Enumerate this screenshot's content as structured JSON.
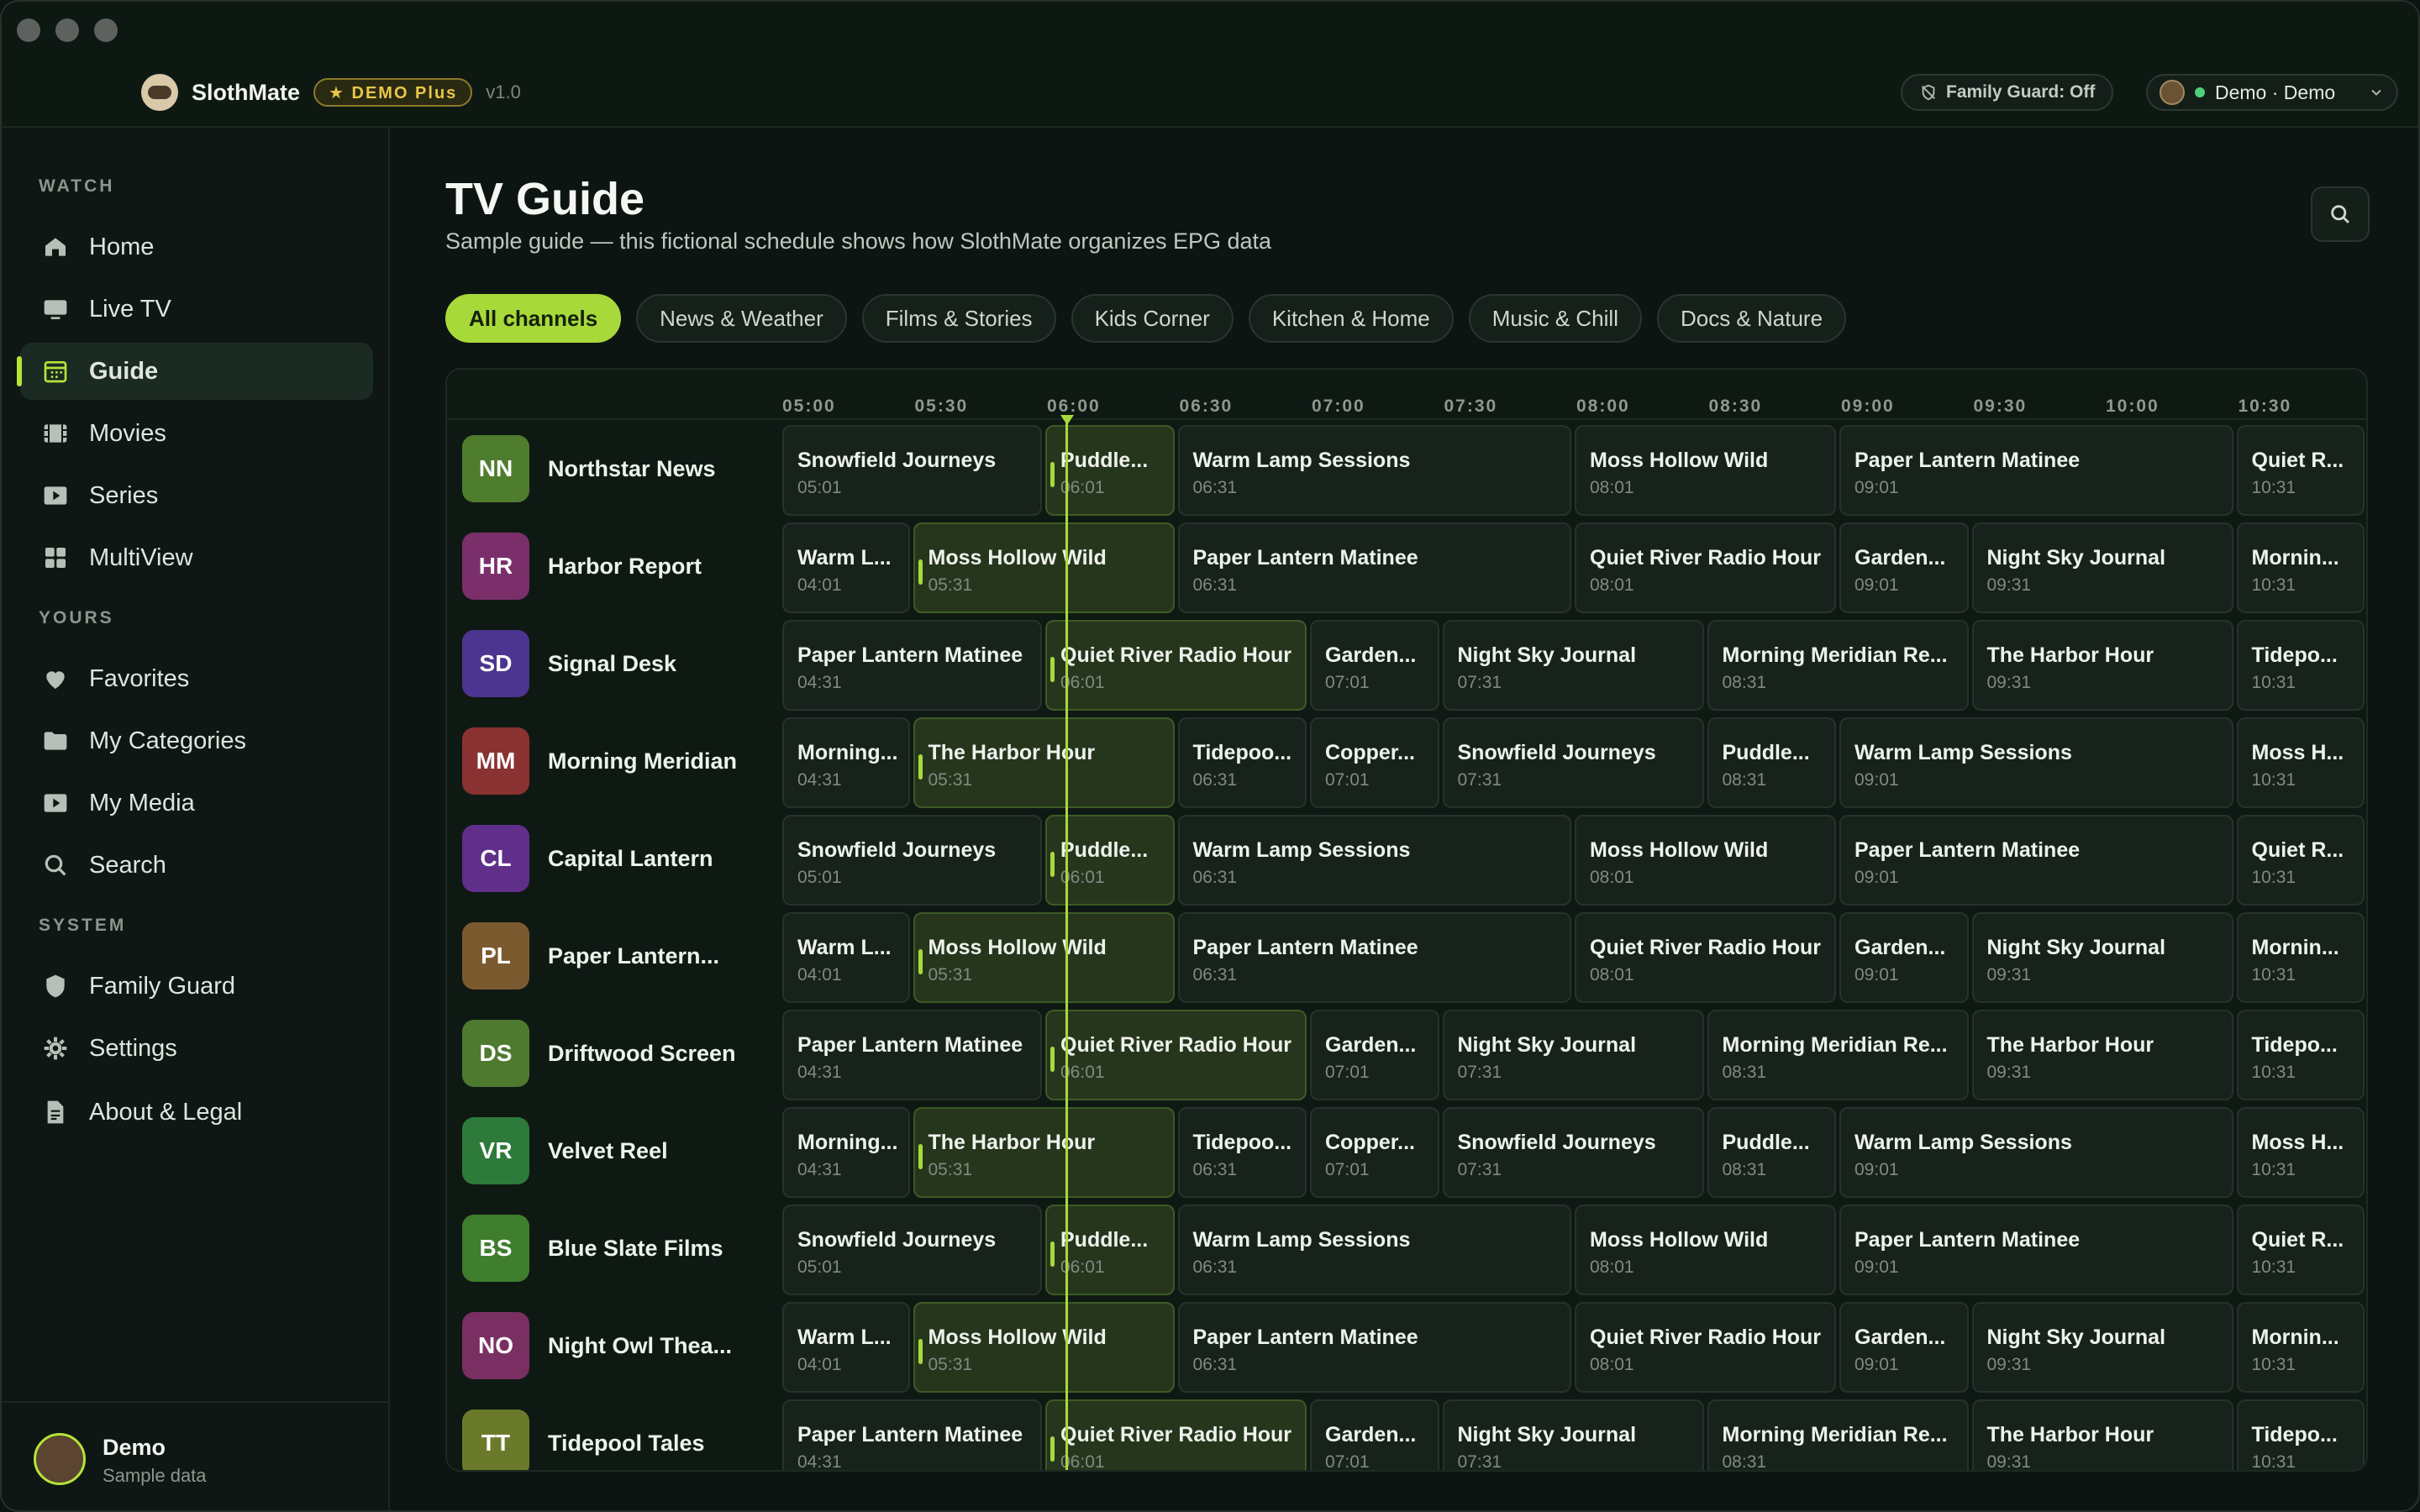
{
  "window": {
    "app_name": "SlothMate",
    "plan_badge": "★ DEMO Plus",
    "version": "v1.0"
  },
  "header": {
    "family_guard": "Family Guard: Off",
    "user_label": "Demo · Demo"
  },
  "sidebar": {
    "sections": [
      {
        "title": "WATCH",
        "items": [
          {
            "label": "Home",
            "icon": "home-icon"
          },
          {
            "label": "Live TV",
            "icon": "tv-icon"
          },
          {
            "label": "Guide",
            "icon": "grid-calendar-icon",
            "active": true
          },
          {
            "label": "Movies",
            "icon": "film-icon"
          },
          {
            "label": "Series",
            "icon": "play-square-icon"
          },
          {
            "label": "MultiView",
            "icon": "four-squares-icon"
          }
        ]
      },
      {
        "title": "YOURS",
        "items": [
          {
            "label": "Favorites",
            "icon": "heart-icon"
          },
          {
            "label": "My Categories",
            "icon": "folder-icon"
          },
          {
            "label": "My Media",
            "icon": "play-square-icon"
          },
          {
            "label": "Search",
            "icon": "search-icon"
          }
        ]
      },
      {
        "title": "SYSTEM",
        "items": [
          {
            "label": "Family Guard",
            "icon": "shield-icon"
          },
          {
            "label": "Settings",
            "icon": "gear-icon"
          },
          {
            "label": "About & Legal",
            "icon": "document-icon"
          }
        ]
      }
    ],
    "footer": {
      "name": "Demo",
      "sub": "Sample data"
    }
  },
  "main": {
    "title": "TV Guide",
    "subtitle": "Sample guide — this fictional schedule shows how SlothMate organizes EPG data",
    "chips": [
      "All channels",
      "News & Weather",
      "Films & Stories",
      "Kids Corner",
      "Kitchen & Home",
      "Music & Chill",
      "Docs & Nature"
    ],
    "active_chip": "All channels"
  },
  "guide": {
    "times": [
      "05:00",
      "05:30",
      "06:00",
      "06:30",
      "07:00",
      "07:30",
      "08:00",
      "08:30",
      "09:00",
      "09:30",
      "10:00",
      "10:30"
    ],
    "accent": "#a8d93a",
    "patterns": [
      [
        [
          "Snowfield Journeys",
          "05:01"
        ],
        [
          "Puddle...",
          "06:01"
        ],
        [
          "Warm Lamp Sessions",
          "06:31"
        ],
        [
          "Moss Hollow Wild",
          "08:01"
        ],
        [
          "Paper Lantern Matinee",
          "09:01"
        ],
        [
          "Quiet R...",
          "10:31"
        ]
      ],
      [
        [
          "Warm L...",
          "04:01"
        ],
        [
          "Moss Hollow Wild",
          "05:31"
        ],
        [
          "Paper Lantern Matinee",
          "06:31"
        ],
        [
          "Quiet River Radio Hour",
          "08:01"
        ],
        [
          "Garden...",
          "09:01"
        ],
        [
          "Night Sky Journal",
          "09:31"
        ],
        [
          "Mornin...",
          "10:31"
        ]
      ],
      [
        [
          "Paper Lantern Matinee",
          "04:31"
        ],
        [
          "Quiet River Radio Hour",
          "06:01"
        ],
        [
          "Garden...",
          "07:01"
        ],
        [
          "Night Sky Journal",
          "07:31"
        ],
        [
          "Morning Meridian Re...",
          "08:31"
        ],
        [
          "The Harbor Hour",
          "09:31"
        ],
        [
          "Tidepo...",
          "10:31"
        ]
      ],
      [
        [
          "Morning...",
          "04:31"
        ],
        [
          "The Harbor Hour",
          "05:31"
        ],
        [
          "Tidepoo...",
          "06:31"
        ],
        [
          "Copper...",
          "07:01"
        ],
        [
          "Snowfield Journeys",
          "07:31"
        ],
        [
          "Puddle...",
          "08:31"
        ],
        [
          "Warm Lamp Sessions",
          "09:01"
        ],
        [
          "Moss H...",
          "10:31"
        ]
      ]
    ],
    "channels": [
      {
        "abbr": "NN",
        "name": "Northstar News",
        "color": "#4f7d2e",
        "pattern": 0
      },
      {
        "abbr": "HR",
        "name": "Harbor Report",
        "color": "#7a2f6a",
        "pattern": 1
      },
      {
        "abbr": "SD",
        "name": "Signal Desk",
        "color": "#4b3590",
        "pattern": 2
      },
      {
        "abbr": "MM",
        "name": "Morning Meridian",
        "color": "#8a3232",
        "pattern": 3
      },
      {
        "abbr": "CL",
        "name": "Capital Lantern",
        "color": "#5f2f8a",
        "pattern": 0
      },
      {
        "abbr": "PL",
        "name": "Paper Lantern...",
        "color": "#7c5a30",
        "pattern": 1
      },
      {
        "abbr": "DS",
        "name": "Driftwood Screen",
        "color": "#4e7a30",
        "pattern": 2
      },
      {
        "abbr": "VR",
        "name": "Velvet Reel",
        "color": "#2e7a3a",
        "pattern": 3
      },
      {
        "abbr": "BS",
        "name": "Blue Slate Films",
        "color": "#3f7e2c",
        "pattern": 0
      },
      {
        "abbr": "NO",
        "name": "Night Owl Thea...",
        "color": "#7a2f62",
        "pattern": 1
      },
      {
        "abbr": "TT",
        "name": "Tidepool Tales",
        "color": "#6a7a2a",
        "pattern": 2
      }
    ]
  }
}
